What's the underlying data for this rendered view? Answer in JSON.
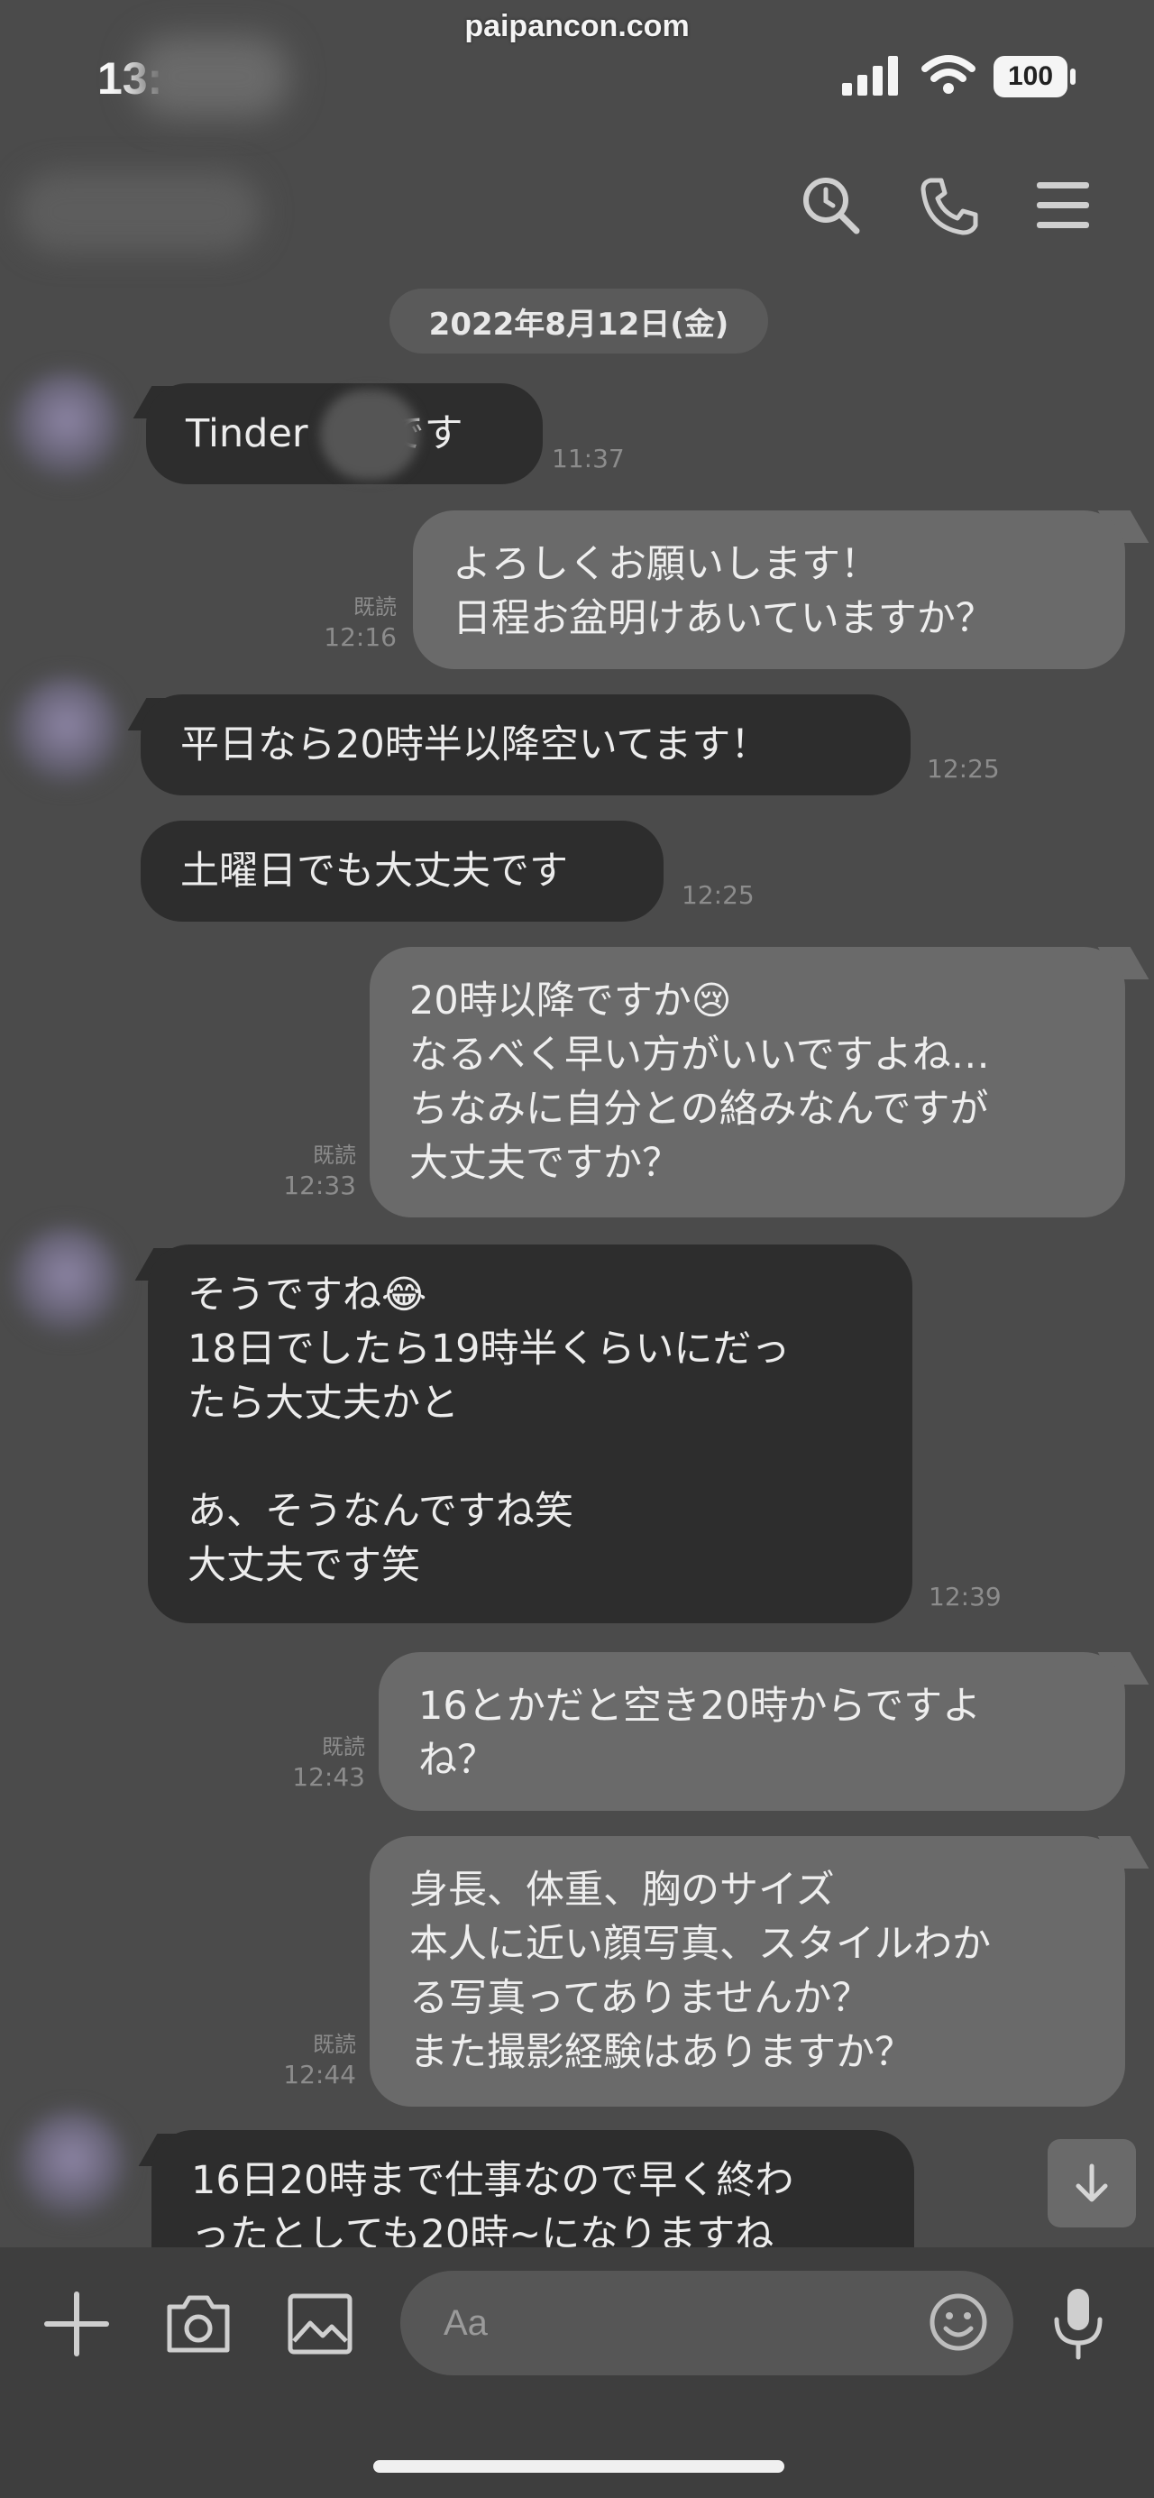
{
  "watermark": "paipancon.com",
  "status": {
    "time": "13:",
    "battery": "100"
  },
  "date_label": "2022年8月12日(金)",
  "messages": [
    {
      "text": "Tinder　　です",
      "time": "11:37",
      "read": ""
    },
    {
      "text": "よろしくお願いします！\n日程お盆明けあいていますか？",
      "time": "12:16",
      "read": "既読"
    },
    {
      "text": "平日なら20時半以降空いてます！",
      "time": "12:25",
      "read": ""
    },
    {
      "text": "土曜日でも大丈夫です",
      "time": "12:25",
      "read": ""
    },
    {
      "text": "20時以降ですか😢\nなるべく早い方がいいですよね…\nちなみに自分との絡みなんですが\n大丈夫ですか？",
      "time": "12:33",
      "read": "既読"
    },
    {
      "text": "そうですね😂\n18日でしたら19時半くらいにだっ\nたら大丈夫かと\n\nあ、そうなんですね笑\n大丈夫です笑",
      "time": "12:39",
      "read": ""
    },
    {
      "text": "16とかだと空き20時からですよ\nね？",
      "time": "12:43",
      "read": "既読"
    },
    {
      "text": "身長、体重、胸のサイズ\n本人に近い顔写真、スタイルわか\nる写真ってありませんか？\nまた撮影経験はありますか？",
      "time": "12:44",
      "read": "既読"
    },
    {
      "text": "16日20時まで仕事なので早く終わ\nったとしても20時~になりますね",
      "time": "",
      "read": ""
    }
  ],
  "input": {
    "placeholder": "Aa"
  },
  "icons": {
    "header": [
      "search-icon",
      "phone-icon",
      "menu-icon"
    ],
    "toolbar": [
      "plus-icon",
      "camera-icon",
      "image-icon",
      "emoji-icon",
      "mic-icon"
    ]
  }
}
